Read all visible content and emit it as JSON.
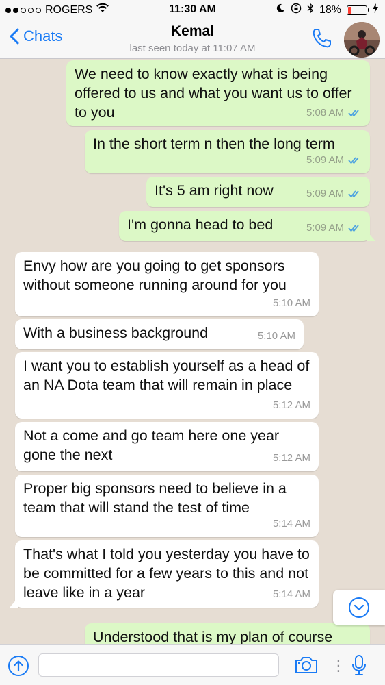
{
  "status_bar": {
    "carrier": "ROGERS",
    "time": "11:30 AM",
    "battery_percent": "18%",
    "battery_level": 0.18,
    "battery_color": "#ff3b30"
  },
  "nav": {
    "back_label": "Chats",
    "contact_name": "Kemal",
    "last_seen": "last seen today at 11:07 AM",
    "accent_color": "#1a7bf5"
  },
  "messages": [
    {
      "dir": "out",
      "text": "We need to know exactly what is being offered to us and what you want us to offer to you",
      "time": "5:08 AM",
      "read": true
    },
    {
      "dir": "out",
      "text": "In the short term n then the long term",
      "time": "5:09 AM",
      "read": true
    },
    {
      "dir": "out",
      "text": "It's 5 am right now",
      "time": "5:09 AM",
      "read": true
    },
    {
      "dir": "out",
      "text": "I'm gonna head to bed",
      "time": "5:09 AM",
      "read": true
    },
    {
      "dir": "in",
      "text": "Envy how are you going to get sponsors without someone running around for you",
      "time": "5:10 AM"
    },
    {
      "dir": "in",
      "text": "With a business background",
      "time": "5:10 AM"
    },
    {
      "dir": "in",
      "text": "I want you to establish yourself as a head of an NA Dota team that will remain in place",
      "time": "5:12 AM"
    },
    {
      "dir": "in",
      "text": "Not a come and go team here one year gone the next",
      "time": "5:12 AM"
    },
    {
      "dir": "in",
      "text": "Proper big sponsors need to believe in a team that will stand the test of time",
      "time": "5:14 AM"
    },
    {
      "dir": "in",
      "text": "That's what I told you yesterday you have to be committed for a few years to this and not leave like in a year",
      "time": "5:14 AM"
    },
    {
      "dir": "out",
      "text": "Understood that is my plan of course",
      "time": "",
      "read": false
    }
  ],
  "input_bar": {
    "placeholder": ""
  },
  "colors": {
    "outgoing_bubble": "#dcf8c6",
    "incoming_bubble": "#ffffff",
    "chat_background": "#e6ddd3",
    "read_ticks": "#4fa3e0"
  },
  "icons": [
    "wifi-icon",
    "moon-icon",
    "orientation-lock-icon",
    "bluetooth-icon",
    "battery-icon",
    "charging-icon",
    "back-chevron-icon",
    "phone-icon",
    "double-check-icon",
    "scroll-down-icon",
    "upload-icon",
    "camera-icon",
    "mic-icon"
  ]
}
